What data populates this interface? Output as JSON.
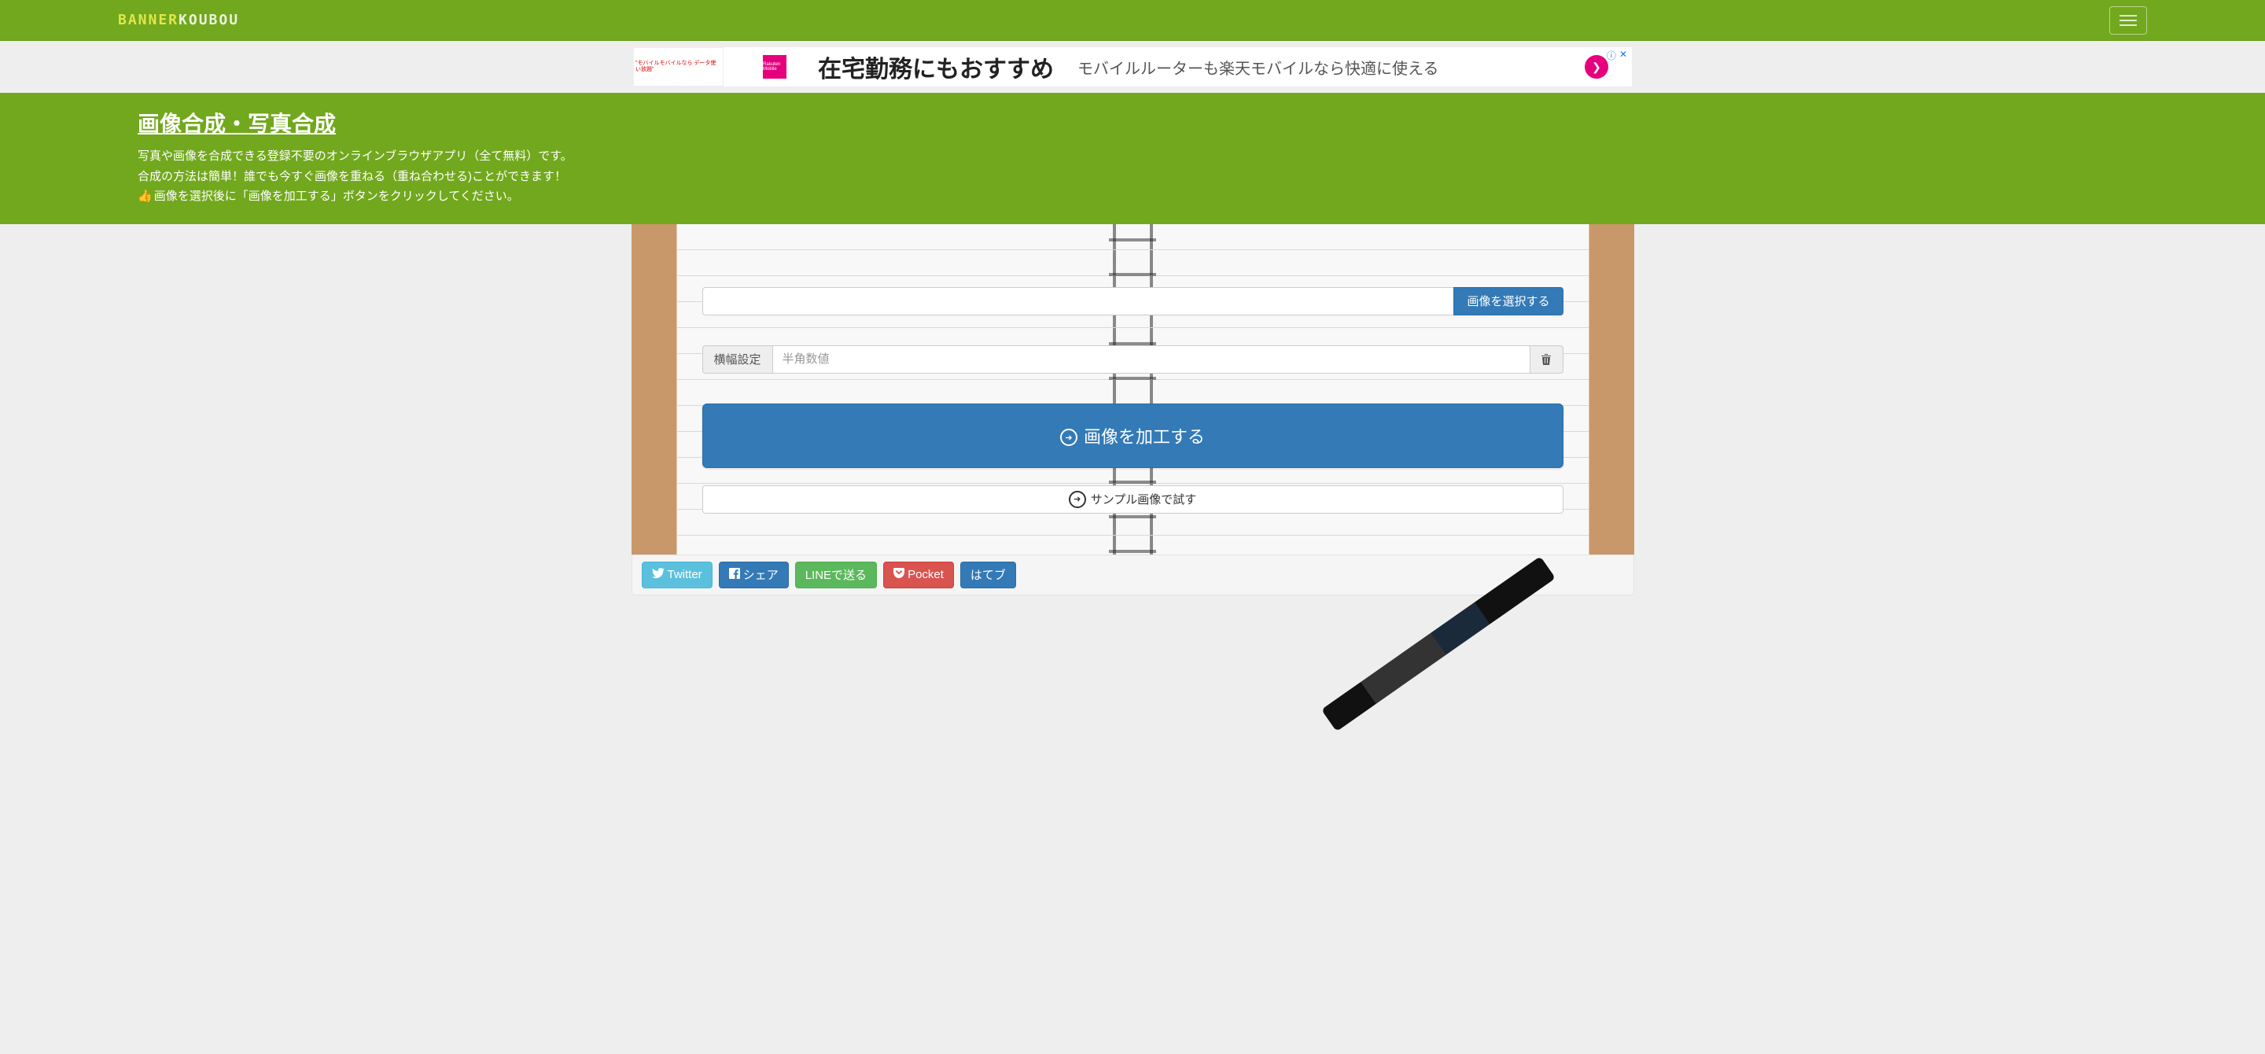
{
  "navbar": {
    "logo_banner": "BANNER",
    "logo_koubou": "KOUBOU"
  },
  "ad": {
    "left_text": "\"モバイルモバイルなら データ使い放題\"",
    "rakuten": "Rakuten Mobile",
    "main_text": "在宅勤務にもおすすめ",
    "sub_text": "モバイルルーターも楽天モバイルなら快適に使える"
  },
  "header": {
    "title": "画像合成・写真合成",
    "desc_line1": "写真や画像を合成できる登録不要のオンラインブラウザアプリ（全て無料）です。",
    "desc_line2": "合成の方法は簡単！誰でも今すぐ画像を重ねる（重ね合わせる)ことができます！",
    "desc_line3": "画像を選択後に「画像を加工する」ボタンをクリックしてください。"
  },
  "form": {
    "select_label": "画像を選択する",
    "width_label": "横幅設定",
    "width_placeholder": "半角数値",
    "process_label": "画像を加工する",
    "sample_label": "サンプル画像で試す"
  },
  "share": {
    "twitter": "Twitter",
    "facebook": "シェア",
    "line": "LINEで送る",
    "pocket": "Pocket",
    "hatena": "はてブ"
  }
}
